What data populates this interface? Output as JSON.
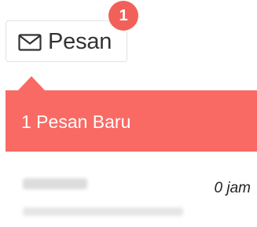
{
  "message_button": {
    "icon": "envelope-icon",
    "label": "Pesan"
  },
  "badge": {
    "count": "1",
    "color": "#f2605a"
  },
  "dropdown": {
    "header_text": "1 Pesan Baru",
    "header_color": "#f96a64",
    "items": [
      {
        "time": "0 jam"
      }
    ]
  }
}
